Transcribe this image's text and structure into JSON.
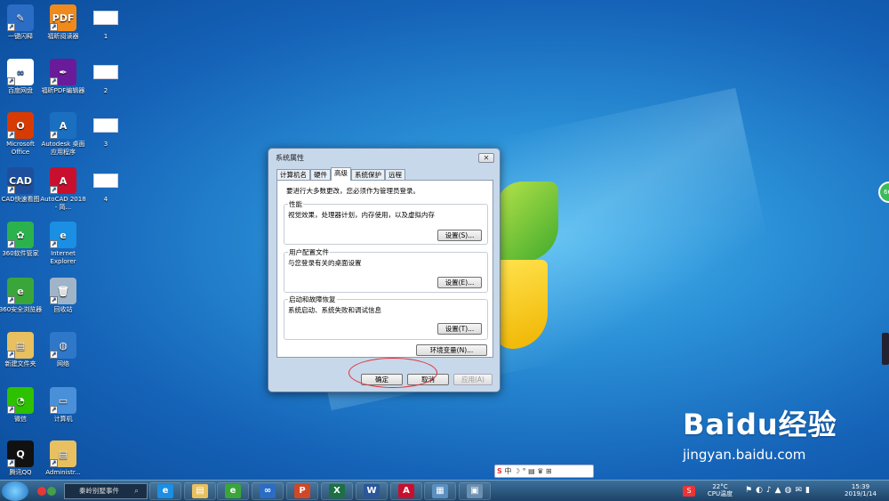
{
  "desktop": {
    "icons": [
      {
        "label": "一键闪释",
        "color": "#2b6cc4",
        "glyph": "✎"
      },
      {
        "label": "福昕阅读器",
        "color": "#f08a1c",
        "glyph": "PDF"
      },
      {
        "label": "1",
        "thumb": true
      },
      {
        "label": "百度网盘",
        "color": "#ffffff",
        "glyph": "∞"
      },
      {
        "label": "福昕PDF编辑器",
        "color": "#6a1b9a",
        "glyph": "✒"
      },
      {
        "label": "2",
        "thumb": true
      },
      {
        "label": "Microsoft Office",
        "color": "#d83b01",
        "glyph": "O"
      },
      {
        "label": "Autodesk 桌面应用程序",
        "color": "#1b6fc0",
        "glyph": "A"
      },
      {
        "label": "3",
        "thumb": true
      },
      {
        "label": "CAD快速看图",
        "color": "#1e4f9c",
        "glyph": "CAD"
      },
      {
        "label": "AutoCAD 2018 - 简...",
        "color": "#c8102e",
        "glyph": "A"
      },
      {
        "label": "4",
        "thumb": true
      },
      {
        "label": "360软件管家",
        "color": "#2bb24c",
        "glyph": "✿"
      },
      {
        "label": "Internet Explorer",
        "color": "#1a8fe3",
        "glyph": "e"
      },
      {
        "label": "360安全浏览器",
        "color": "#3aa63a",
        "glyph": "e"
      },
      {
        "label": "回收站",
        "color": "#9fb4c8",
        "glyph": "🗑"
      },
      {
        "label": "新建文件夹",
        "color": "#e8c060",
        "glyph": "▤"
      },
      {
        "label": "网络",
        "color": "#2e77c9",
        "glyph": "◍"
      },
      {
        "label": "微信",
        "color": "#2dc100",
        "glyph": "◔"
      },
      {
        "label": "计算机",
        "color": "#4a90d9",
        "glyph": "▭"
      },
      {
        "label": "腾讯QQ",
        "color": "#111111",
        "glyph": "Q"
      },
      {
        "label": "Administr...",
        "color": "#e8c060",
        "glyph": "▤"
      }
    ],
    "side_bubble": "66"
  },
  "dialog": {
    "title": "系统属性",
    "close_glyph": "✕",
    "tabs": [
      "计算机名",
      "硬件",
      "高级",
      "系统保护",
      "远程"
    ],
    "active_tab": "高级",
    "admin_note": "要进行大多数更改，您必须作为管理员登录。",
    "groups": [
      {
        "title": "性能",
        "description": "视觉效果，处理器计划，内存使用，以及虚拟内存",
        "button": "设置(S)..."
      },
      {
        "title": "用户配置文件",
        "description": "与您登录有关的桌面设置",
        "button": "设置(E)..."
      },
      {
        "title": "启动和故障恢复",
        "description": "系统启动、系统失败和调试信息",
        "button": "设置(T)..."
      }
    ],
    "env_button": "环境变量(N)...",
    "ok_button": "确定",
    "cancel_button": "取消",
    "apply_button": "应用(A)"
  },
  "taskbar": {
    "search_text": "秦岭别墅事件",
    "apps": [
      {
        "name": "ie",
        "glyph": "e",
        "color": "#1a8fe3"
      },
      {
        "name": "explorer",
        "glyph": "▤",
        "color": "#e8c060"
      },
      {
        "name": "360browser",
        "glyph": "e",
        "color": "#3aa63a"
      },
      {
        "name": "baidunetdisk",
        "glyph": "∞",
        "color": "#2b6cc4"
      },
      {
        "name": "powerpoint",
        "glyph": "P",
        "color": "#d24726"
      },
      {
        "name": "excel",
        "glyph": "X",
        "color": "#1d7044"
      },
      {
        "name": "word",
        "glyph": "W",
        "color": "#2b579a"
      },
      {
        "name": "autocad",
        "glyph": "A",
        "color": "#c8102e"
      },
      {
        "name": "system",
        "glyph": "▦",
        "color": "#5a8fc0"
      },
      {
        "name": "network",
        "glyph": "▣",
        "color": "#6a8fb0"
      }
    ],
    "cpu_temp": "22°C",
    "cpu_label": "CPU温度",
    "time": "15:39",
    "date": "2019/1/14"
  },
  "ime_bar": {
    "logo": "S",
    "text": "中 ☽ ° ▤ ♛ ⊞"
  },
  "watermark": {
    "main": "Baidu经验",
    "sub": "jingyan.baidu.com"
  }
}
